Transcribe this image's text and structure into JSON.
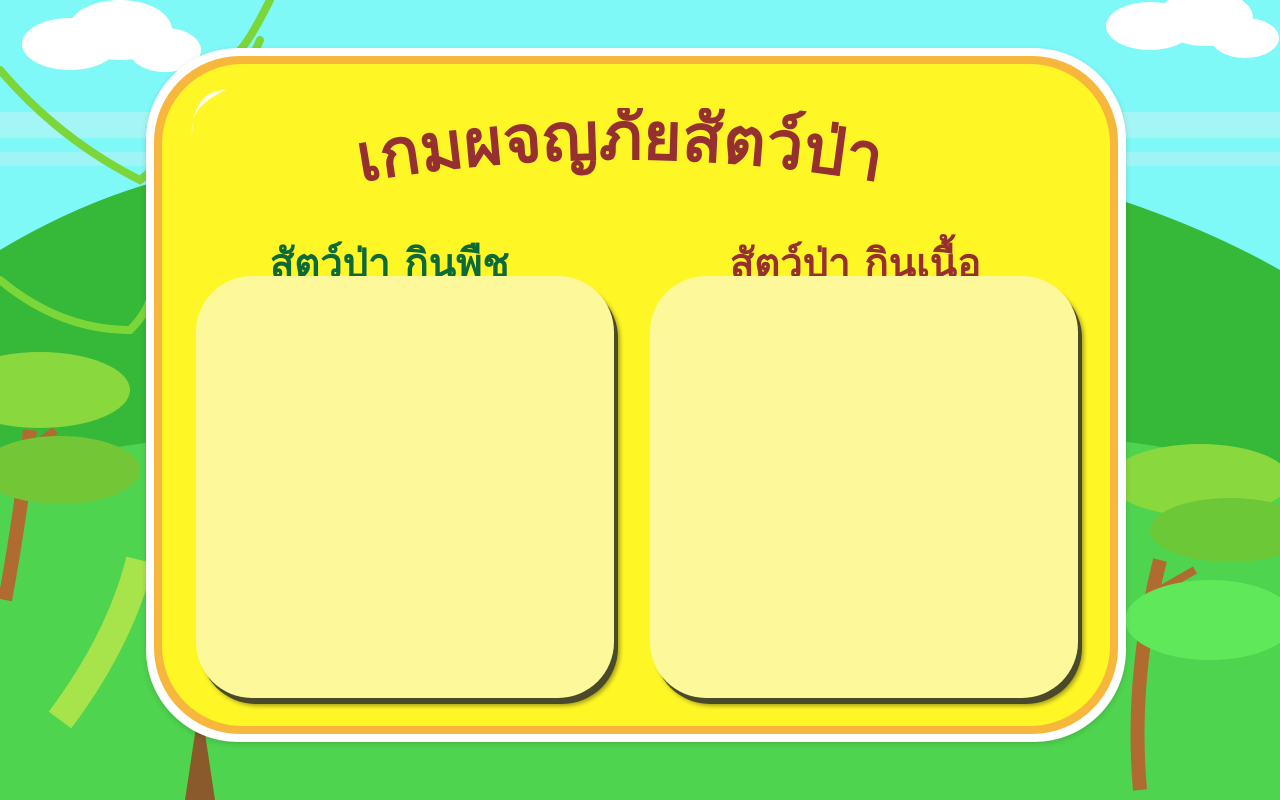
{
  "game": {
    "title": "เกมผจญภัยสัตว์ป่า",
    "columns": [
      {
        "label": "สัตว์ป่า กินพืช"
      },
      {
        "label": "สัตว์ป่า กินเนื้อ"
      }
    ]
  },
  "colors": {
    "sky": "#7ff8f8",
    "hill": "#4fd44f",
    "board_fill": "#fff625",
    "board_rim": "#f6b73c",
    "zone_fill": "#fdf89a",
    "title": "#962f2f",
    "herbivore_label": "#0c6a38",
    "carnivore_label": "#962f2f"
  },
  "icons": [
    "vine-decoration",
    "tree-decoration",
    "cloud-decoration"
  ]
}
